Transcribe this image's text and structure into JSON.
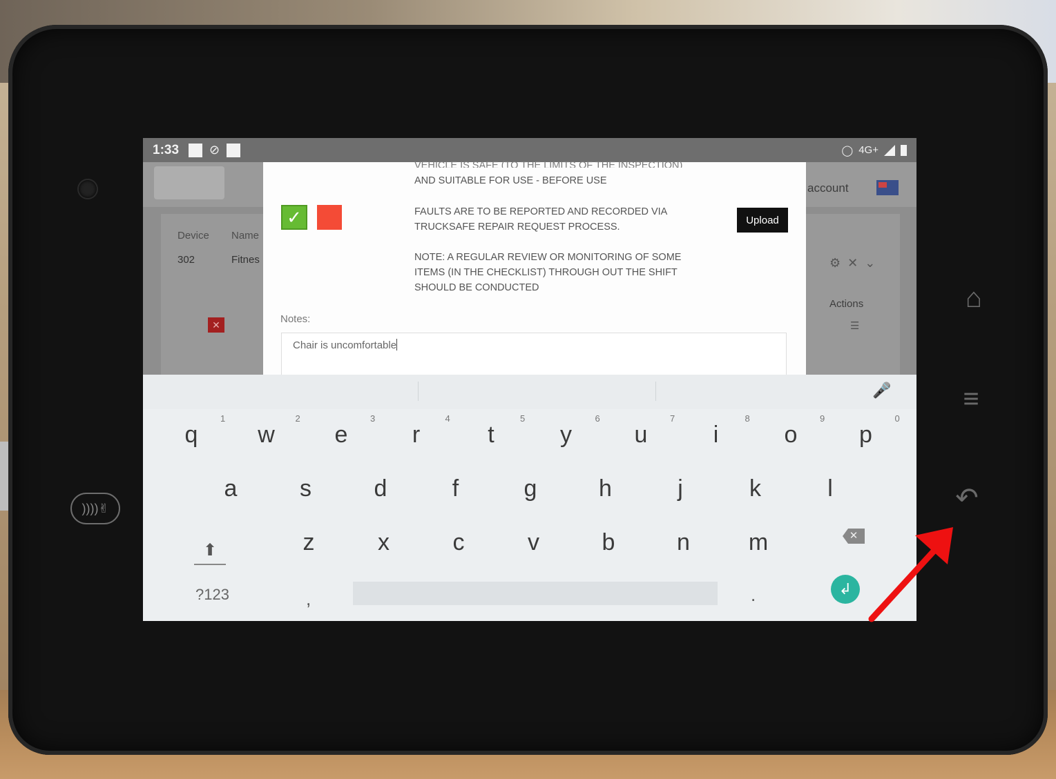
{
  "statusbar": {
    "time": "1:33",
    "network": "4G+"
  },
  "app": {
    "account_label": "account",
    "table": {
      "headers": [
        "Device",
        "Name"
      ],
      "rows": [
        [
          "302",
          "Fitnes"
        ]
      ],
      "actions_header": "Actions"
    }
  },
  "modal": {
    "text_cut": "VEHICLE IS SAFE (TO THE LIMITS OF THE INSPECTION)",
    "text_1": "AND SUITABLE FOR USE - BEFORE USE",
    "text_2a": "FAULTS ARE TO BE REPORTED AND RECORDED VIA",
    "text_2b": "TRUCKSAFE REPAIR REQUEST PROCESS.",
    "text_3a": "NOTE:  A REGULAR REVIEW OR MONITORING OF SOME",
    "text_3b": "ITEMS  (IN THE CHECKLIST) THROUGH OUT THE SHIFT",
    "text_3c": "SHOULD BE CONDUCTED",
    "upload_label": "Upload",
    "notes_label": "Notes:",
    "notes_value": "Chair is uncomfortable"
  },
  "keyboard": {
    "row1": [
      "q",
      "w",
      "e",
      "r",
      "t",
      "y",
      "u",
      "i",
      "o",
      "p"
    ],
    "row1_nums": [
      "1",
      "2",
      "3",
      "4",
      "5",
      "6",
      "7",
      "8",
      "9",
      "0"
    ],
    "row2": [
      "a",
      "s",
      "d",
      "f",
      "g",
      "h",
      "j",
      "k",
      "l"
    ],
    "row3": [
      "z",
      "x",
      "c",
      "v",
      "b",
      "n",
      "m"
    ],
    "symbols_label": "?123",
    "comma": ",",
    "period": "."
  },
  "colors": {
    "accept": "#66bb33",
    "reject": "#f44b36",
    "enter_key": "#2bb5a0",
    "annotation_arrow": "#ee1111"
  },
  "icons": {
    "check": "checkmark-icon",
    "mic": "microphone-icon",
    "shift": "shift-arrow-icon",
    "backspace": "backspace-icon",
    "enter": "enter-return-icon",
    "home": "home-icon",
    "menu": "menu-icon",
    "back": "back-arrow-icon",
    "nfc": "nfc-contactless-icon"
  }
}
